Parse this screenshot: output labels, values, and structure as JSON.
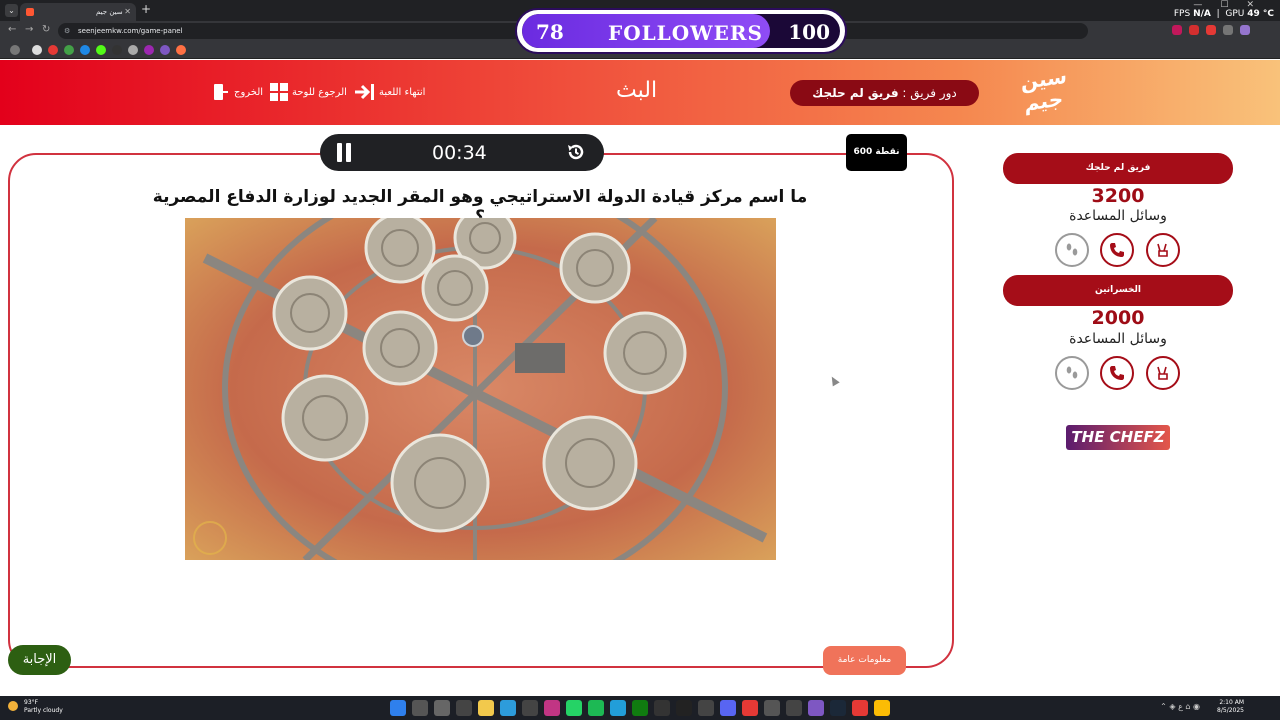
{
  "browser": {
    "tab_title": "سين جيم",
    "url": "seenjeemkw.com/game-panel"
  },
  "overlay": {
    "followers_count": "78",
    "followers_label": "FOLLOWERS",
    "followers_goal": "100",
    "progress_fraction": 0.78
  },
  "hud": {
    "fps_label": "FPS",
    "fps_value": "N/A",
    "gpu_label": "GPU",
    "gpu_value": "49 °C"
  },
  "header": {
    "exit_label": "الخروج",
    "back_label": "الرجوع للوحة",
    "end_game_label": "انتهاء اللعبة",
    "title": "البث",
    "turn_prefix": "دور فريق :",
    "turn_team": "فريق لم حلجك",
    "logo_text": "سين جيم"
  },
  "question": {
    "timer": "00:34",
    "points": "600 نقطة",
    "text": "ما اسم مركز قيادة الدولة الاستراتيجي وهو المقر الجديد لوزارة الدفاع المصرية ؟",
    "answer_button": "الإجابة",
    "info_button": "معلومات عامة"
  },
  "teams": [
    {
      "name": "فريق لم حلجك",
      "score": "3200",
      "aids_label": "وسائل المساعدة"
    },
    {
      "name": "الخسرانين",
      "score": "2000",
      "aids_label": "وسائل المساعدة"
    }
  ],
  "sponsor": "THE CHEFZ",
  "taskbar": {
    "temp": "93°F",
    "weather": "Partly cloudy",
    "time": "2:10 AM",
    "date": "8/5/2025"
  },
  "colors": {
    "accent_red": "#a50d18",
    "answer_green": "#2d5f12",
    "info_orange": "#f0735a"
  }
}
